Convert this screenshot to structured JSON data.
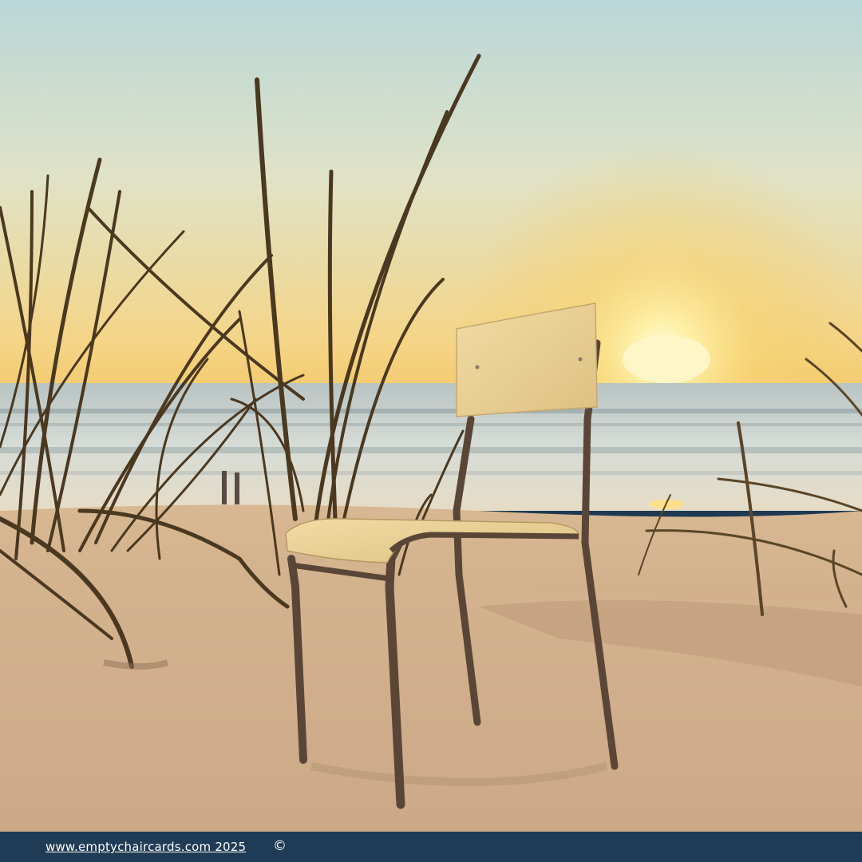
{
  "photo": {
    "subject": "empty wooden chair on sandy beach at sunset",
    "colors": {
      "sky_top": "#bcd8d8",
      "sky_horizon": "#f6d27a",
      "sun": "#fff2b0",
      "sea": "#c9d4d2",
      "sand": "#c9a987",
      "chair_wood": "#e9cf8f",
      "chair_frame": "#5a4636",
      "grass": "#4a3a22"
    }
  },
  "footer": {
    "link_text": "www.emptychaircards.com 2025",
    "copyright_symbol": "©",
    "background": "#203b55"
  }
}
